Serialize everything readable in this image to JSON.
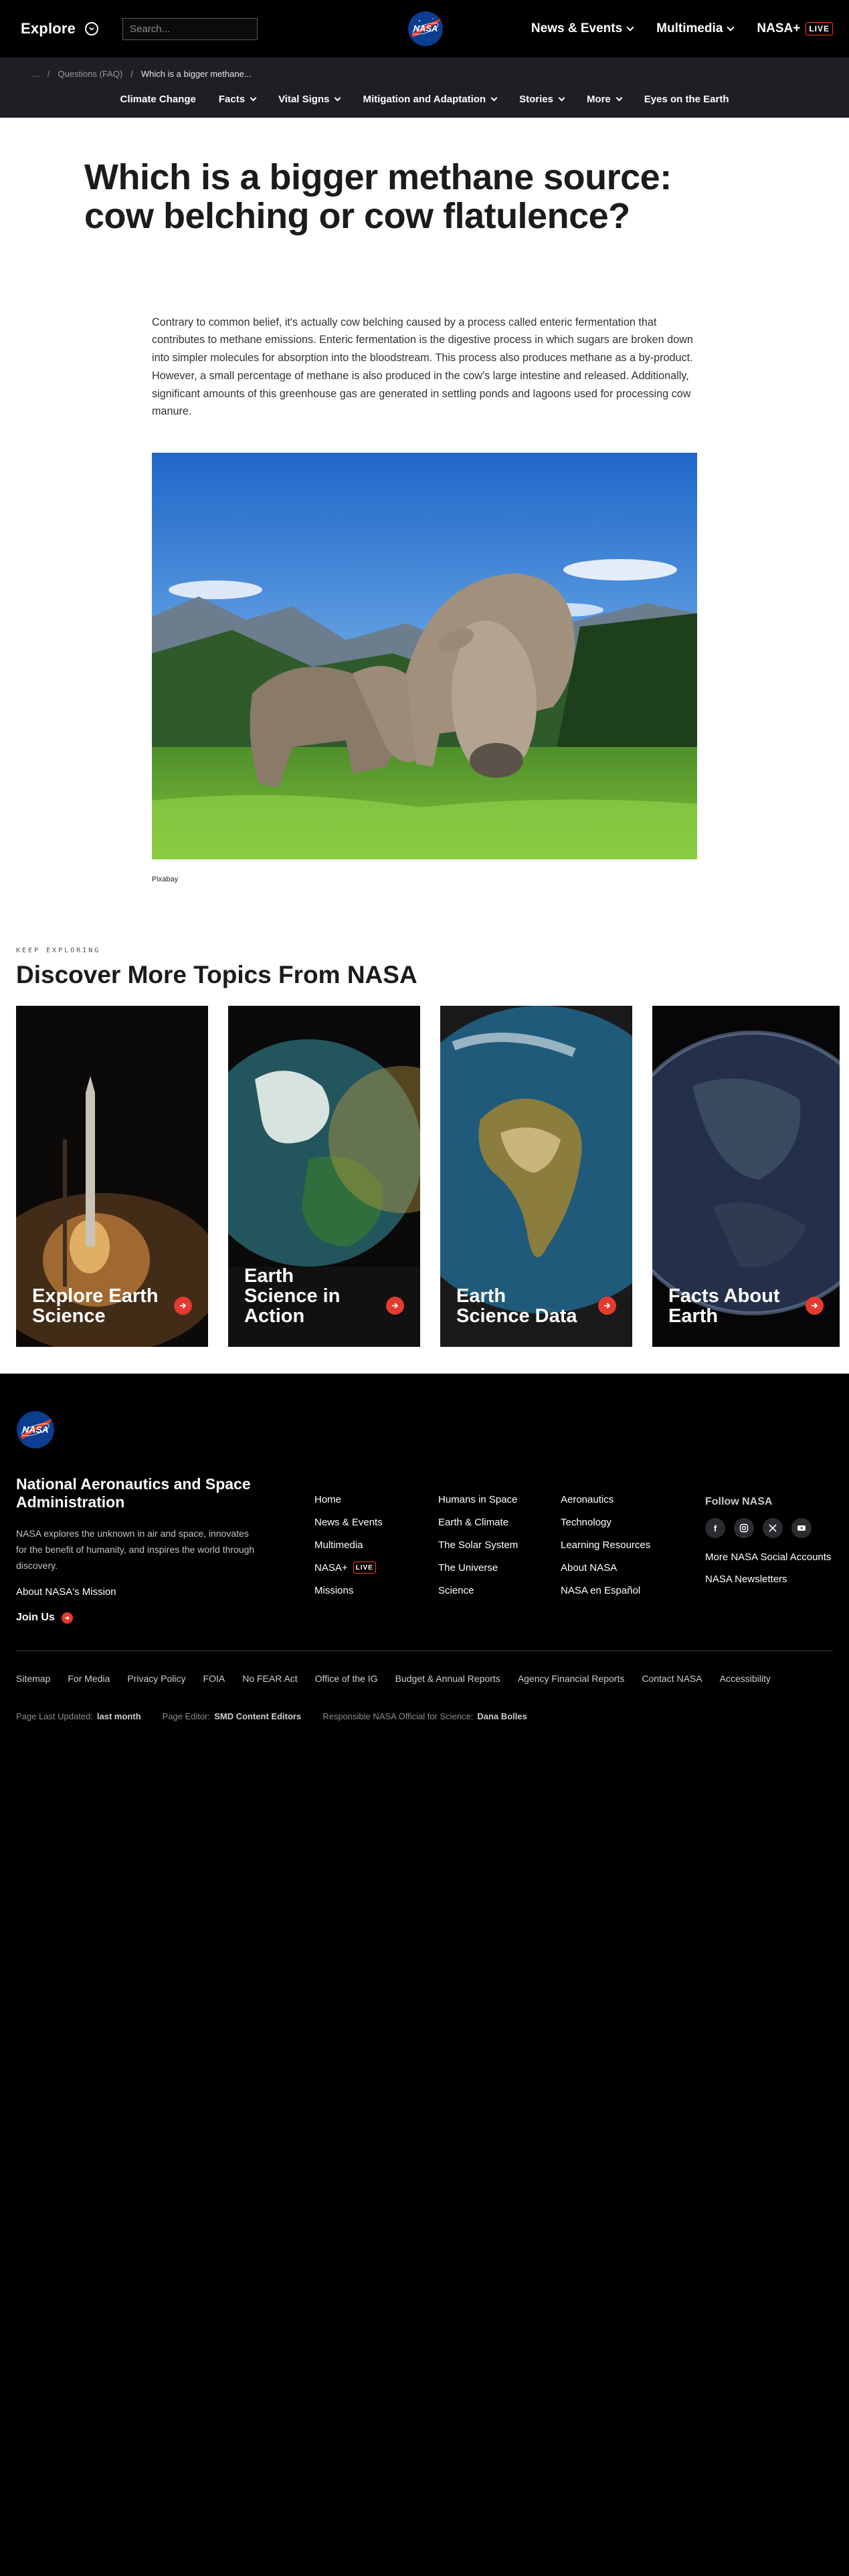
{
  "header": {
    "explore_label": "Explore",
    "search_placeholder": "Search...",
    "nav": [
      {
        "label": "News & Events"
      },
      {
        "label": "Multimedia"
      },
      {
        "label": "NASA+",
        "badge": "LIVE"
      }
    ]
  },
  "breadcrumb": {
    "ellipsis": "...",
    "sep": "/",
    "parent": "Questions (FAQ)",
    "current": "Which is a bigger methane..."
  },
  "subnav": [
    "Climate Change",
    "Facts",
    "Vital Signs",
    "Mitigation and Adaptation",
    "Stories",
    "More",
    "Eyes on the Earth"
  ],
  "article": {
    "title": "Which is a bigger methane source: cow belching or cow flatulence?",
    "body": "Contrary to common belief, it's actually cow belching caused by a process called enteric fermentation that contributes to methane emissions. Enteric fermentation is the digestive process in which sugars are broken down into simpler molecules for absorption into the bloodstream. This process also produces methane as a by-product. However, a small percentage of methane is also produced in the cow's large intestine and released. Additionally, significant amounts of this greenhouse gas are generated in settling ponds and lagoons used for processing cow manure.",
    "image_credit": "Pixabay"
  },
  "explore": {
    "kicker": "KEEP EXPLORING",
    "heading": "Discover More Topics From NASA",
    "cards": [
      {
        "title": "Explore Earth Science"
      },
      {
        "title": "Earth Science in Action"
      },
      {
        "title": "Earth Science Data"
      },
      {
        "title": "Facts About Earth"
      }
    ]
  },
  "footer": {
    "org_name": "National Aeronautics and Space Administration",
    "org_desc": "NASA explores the unknown in air and space, innovates for the benefit of humanity, and inspires the world through discovery.",
    "mission_link": "About NASA's Mission",
    "join_label": "Join Us",
    "col1": [
      "Home",
      "News & Events",
      "Multimedia",
      "NASA+",
      "Missions"
    ],
    "col1_badge": "LIVE",
    "col2": [
      "Humans in Space",
      "Earth & Climate",
      "The Solar System",
      "The Universe",
      "Science"
    ],
    "col3": [
      "Aeronautics",
      "Technology",
      "Learning Resources",
      "About NASA",
      "NASA en Español"
    ],
    "follow_title": "Follow NASA",
    "follow_links": [
      "More NASA Social Accounts",
      "NASA Newsletters"
    ],
    "social_icons": [
      "facebook-icon",
      "instagram-icon",
      "x-icon",
      "youtube-icon"
    ],
    "legal": [
      "Sitemap",
      "For Media",
      "Privacy Policy",
      "FOIA",
      "No FEAR Act",
      "Office of the IG",
      "Budget & Annual Reports",
      "Agency Financial Reports",
      "Contact NASA",
      "Accessibility"
    ],
    "meta": {
      "updated_label": "Page Last Updated:",
      "updated_value": "last month",
      "editor_label": "Page Editor:",
      "editor_value": "SMD Content Editors",
      "official_label": "Responsible NASA Official for Science:",
      "official_value": "Dana Bolles"
    }
  },
  "colors": {
    "accent": "#e53a2f",
    "live": "#fc3d21",
    "subnav_bg": "#1e1f24"
  }
}
